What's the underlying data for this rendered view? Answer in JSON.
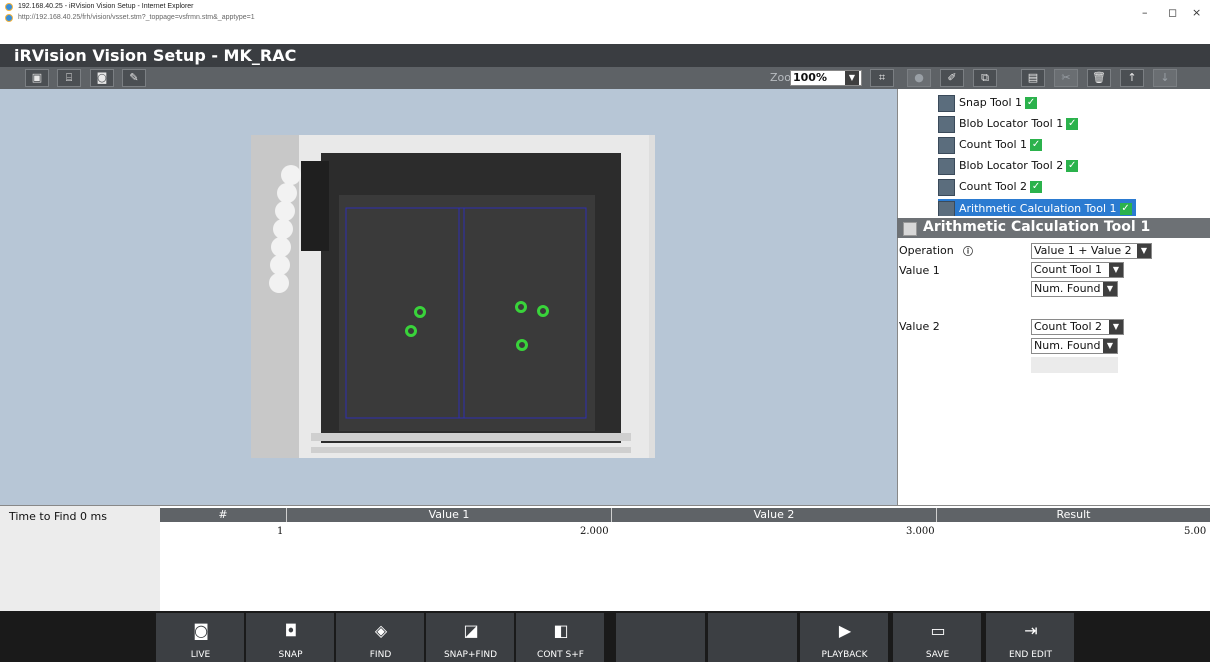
{
  "window": {
    "title": "192.168.40.25 - iRVision Vision Setup - Internet Explorer",
    "url": "http://192.168.40.25/frh/vision/vsset.stm?_toppage=vsfrmn.stm&_apptype=1",
    "controls": [
      "–",
      "◻",
      "×"
    ]
  },
  "app": {
    "title": "iRVision Vision Setup - MK_RAC"
  },
  "toolbar": {
    "zoom_label": "Zoom",
    "zoom_value": "100%"
  },
  "tree": {
    "items": [
      {
        "label": "Snap Tool 1",
        "icon": "camera-icon"
      },
      {
        "label": "Blob Locator Tool 1",
        "icon": "blob-locator-icon"
      },
      {
        "label": "Count Tool 1",
        "icon": "count-tool-icon"
      },
      {
        "label": "Blob Locator Tool 2",
        "icon": "blob-locator-icon"
      },
      {
        "label": "Count Tool 2",
        "icon": "count-tool-icon"
      },
      {
        "label": "Arithmetic Calculation Tool 1",
        "icon": "calculator-icon"
      }
    ]
  },
  "props": {
    "title": "Arithmetic Calculation Tool 1",
    "operation_label": "Operation",
    "operation_value": "Value 1 + Value 2",
    "value1_label": "Value 1",
    "value1_tool": "Count Tool 1",
    "value1_measure": "Num. Found",
    "value2_label": "Value 2",
    "value2_tool": "Count Tool 2",
    "value2_measure": "Num. Found"
  },
  "results": {
    "time_label": "Time to Find",
    "time_value": "0 ms",
    "headers": [
      "#",
      "Value 1",
      "Value 2",
      "Result"
    ],
    "rows": [
      [
        "1",
        "2.000",
        "3.000",
        "5.00"
      ]
    ]
  },
  "bottom_buttons": [
    {
      "label": "LIVE",
      "icon": "live-camera-icon"
    },
    {
      "label": "SNAP",
      "icon": "snap-camera-icon"
    },
    {
      "label": "FIND",
      "icon": "find-icon"
    },
    {
      "label": "SNAP+FIND",
      "icon": "snap-find-icon"
    },
    {
      "label": "CONT S+F",
      "icon": "continuous-snap-find-icon"
    },
    {
      "label": "",
      "icon": ""
    },
    {
      "label": "",
      "icon": ""
    },
    {
      "label": "PLAYBACK",
      "icon": "playback-icon"
    },
    {
      "label": "SAVE",
      "icon": "save-icon"
    },
    {
      "label": "END EDIT",
      "icon": "exit-icon"
    }
  ],
  "colors": {
    "header": "#3a3d41",
    "toolbar": "#5e6266",
    "image_bg": "#b7c6d6",
    "check_green": "#2bb24c",
    "selection_blue": "#2b7bd1",
    "find_marker_green": "#39d33a"
  }
}
